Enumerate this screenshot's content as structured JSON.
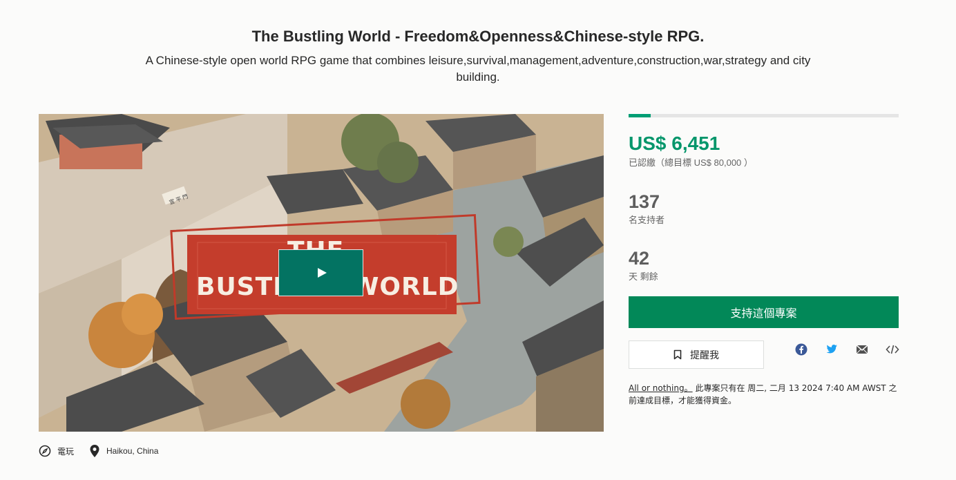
{
  "project": {
    "title": "The Bustling World - Freedom&Openness&Chinese-style RPG.",
    "blurb": "A Chinese-style open world RPG game that combines leisure,survival,management,adventure,construction,war,strategy and city building."
  },
  "media": {
    "banner_line1": "THE",
    "banner_line2": "BUSTLING WORLD",
    "gate_sign": "宣 平 門",
    "play_icon": "play-icon"
  },
  "meta": {
    "category": "電玩",
    "category_icon": "compass-icon",
    "location": "Haikou, China",
    "location_icon": "map-pin-icon"
  },
  "stats": {
    "funded_fraction": 0.081,
    "pledged": "US$ 6,451",
    "pledged_label": "已認繳（總目標 US$ 80,000 ）",
    "backers": "137",
    "backers_label": "名支持者",
    "days": "42",
    "days_label": "天 剩餘"
  },
  "actions": {
    "back_label": "支持這個專案",
    "remind_label": "提醒我",
    "remind_icon": "bookmark-icon",
    "share": [
      "facebook-icon",
      "twitter-icon",
      "email-icon",
      "embed-icon"
    ]
  },
  "note": {
    "link": "All or nothing。",
    "text": "此專案只有在 周二, 二月 13 2024 7:40 AM AWST 之前達成目標，才能獲得資金。"
  },
  "colors": {
    "accent_green": "#05966b",
    "button_green": "#028858",
    "play_green": "#037362",
    "facebook": "#3b5998",
    "twitter": "#1da1f2"
  }
}
